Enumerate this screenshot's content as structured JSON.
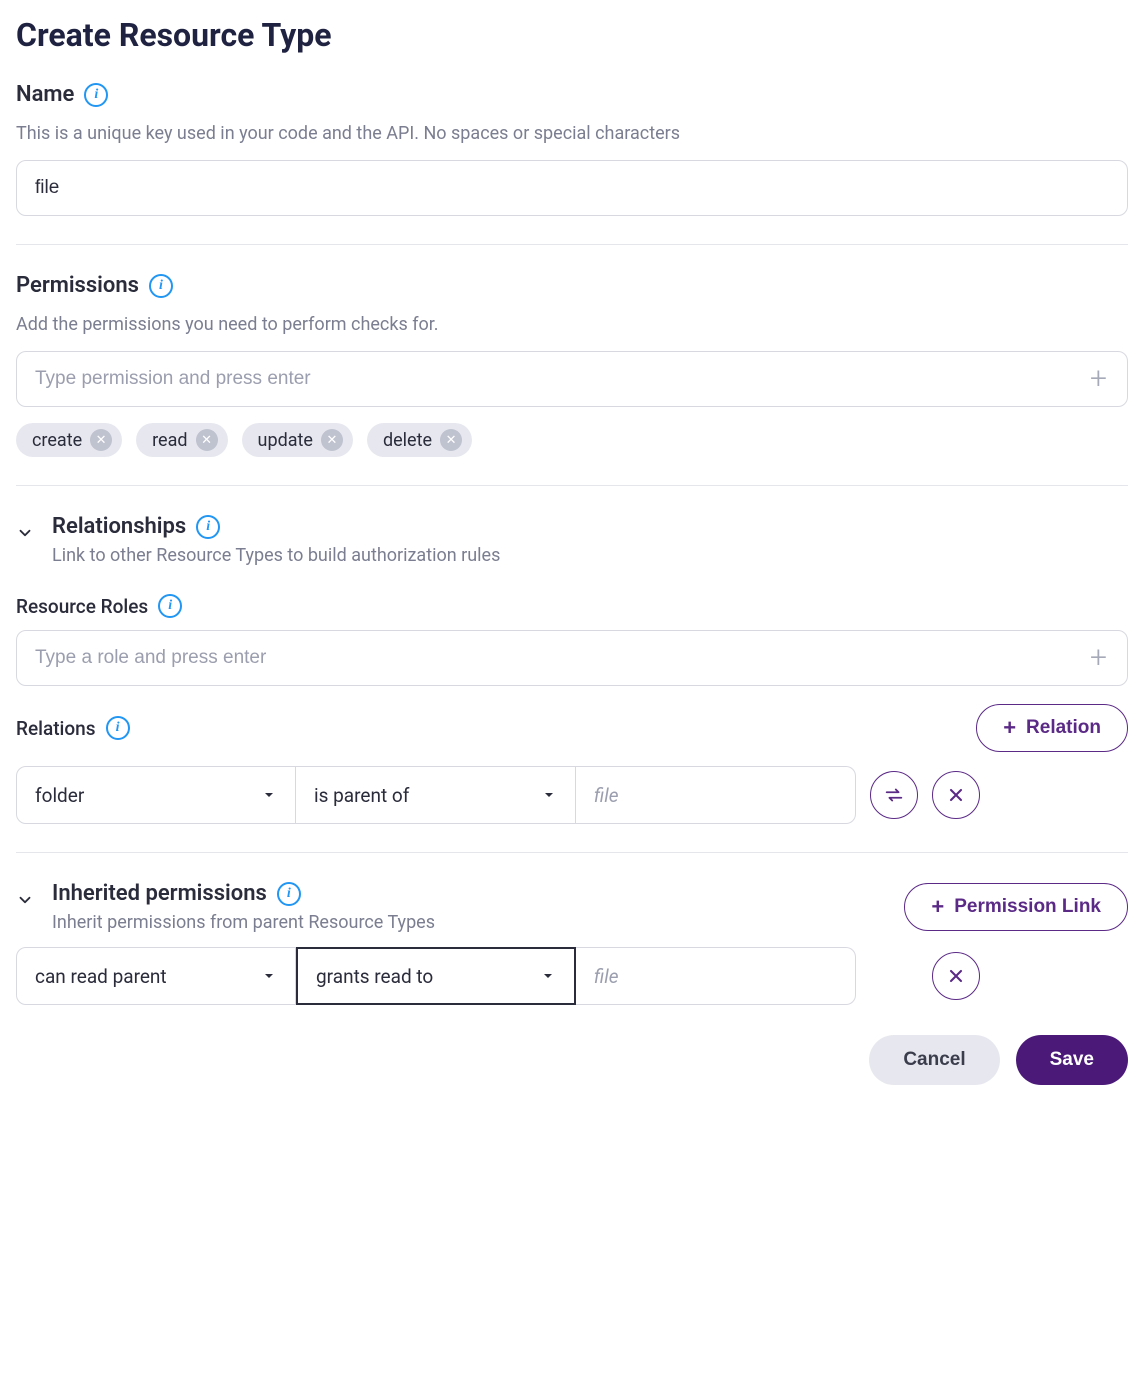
{
  "title": "Create Resource Type",
  "name": {
    "label": "Name",
    "help": "This is a unique key used in your code and the API. No spaces or special characters",
    "value": "file"
  },
  "permissions": {
    "label": "Permissions",
    "help": "Add the permissions you need to perform checks for.",
    "placeholder": "Type permission and press enter",
    "chips": [
      {
        "label": "create"
      },
      {
        "label": "read"
      },
      {
        "label": "update"
      },
      {
        "label": "delete"
      }
    ]
  },
  "relationships": {
    "label": "Relationships",
    "help": "Link to other Resource Types to build authorization rules",
    "roles": {
      "label": "Resource Roles",
      "placeholder": "Type a role and press enter"
    },
    "relations": {
      "label": "Relations",
      "button": "Relation",
      "row": {
        "subject": "folder",
        "predicate": "is parent of",
        "object_placeholder": "file"
      }
    }
  },
  "inherited": {
    "label": "Inherited permissions",
    "help": "Inherit permissions from parent Resource Types",
    "button": "Permission Link",
    "row": {
      "condition": "can read parent",
      "grant": "grants read to",
      "object_placeholder": "file"
    }
  },
  "footer": {
    "cancel": "Cancel",
    "save": "Save"
  }
}
